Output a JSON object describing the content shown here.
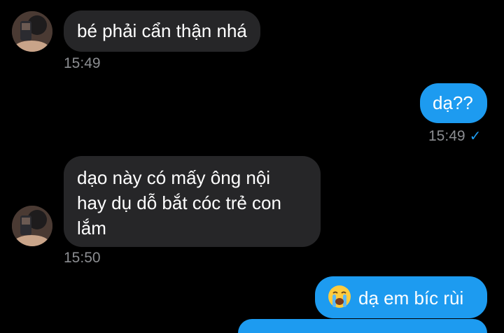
{
  "messages": [
    {
      "direction": "incoming",
      "text": "bé phải cẩn thận nhá",
      "time": "15:49"
    },
    {
      "direction": "outgoing",
      "text": "dạ??",
      "time": "15:49",
      "status_icon": "check-icon"
    },
    {
      "direction": "incoming",
      "lines": [
        "dạo này có mấy ông nội",
        "hay dụ dỗ bắt cóc trẻ con",
        "lắm"
      ],
      "time": "15:50"
    },
    {
      "direction": "outgoing",
      "emoji": "loudly-crying-face-emoji",
      "text": "dạ em bíc rùi"
    }
  ],
  "colors": {
    "background": "#000000",
    "incoming_bubble": "#262628",
    "outgoing_bubble": "#1d9bf0",
    "timestamp": "#8b8d91",
    "check": "#1d9bf0"
  }
}
